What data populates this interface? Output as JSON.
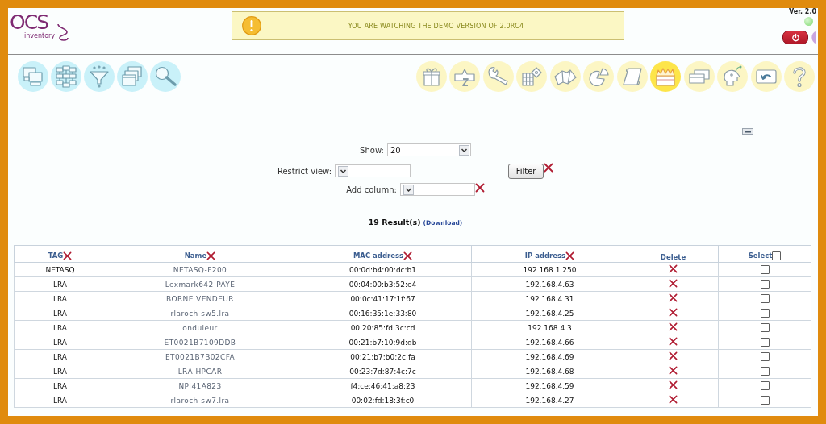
{
  "header": {
    "logo": {
      "name": "OCS",
      "subtitle": "inventory"
    },
    "demo_notice": "YOU ARE WATCHING THE DEMO VERSION OF 2.0RC4",
    "version": "Ver. 2.0"
  },
  "toolbar_left": [
    {
      "selected": false
    },
    {
      "selected": false
    },
    {
      "selected": false
    },
    {
      "selected": false
    },
    {
      "selected": false
    }
  ],
  "toolbar_right": [
    {
      "selected": false
    },
    {
      "selected": false
    },
    {
      "selected": false
    },
    {
      "selected": false
    },
    {
      "selected": false
    },
    {
      "selected": false
    },
    {
      "selected": false
    },
    {
      "selected": true
    },
    {
      "selected": false
    },
    {
      "selected": false
    },
    {
      "selected": false
    },
    {
      "selected": false
    }
  ],
  "filters": {
    "show": {
      "label": "Show:",
      "value": "20"
    },
    "restrict_view": {
      "label": "Restrict view:"
    },
    "filter_button": "Filter",
    "add_column": {
      "label": "Add column:"
    }
  },
  "results": {
    "count": "19 Result(s)",
    "download": "(Download)"
  },
  "table": {
    "columns": [
      {
        "label": "TAG",
        "kind": "text"
      },
      {
        "label": "Name",
        "kind": "link"
      },
      {
        "label": "MAC address",
        "kind": "text"
      },
      {
        "label": "IP address",
        "kind": "text"
      },
      {
        "label": "Delete",
        "kind": "delete"
      },
      {
        "label": "Select",
        "kind": "select",
        "checked": false
      }
    ],
    "rows": [
      {
        "cells": [
          "NETASQ",
          "NETASQ-F200",
          "00:0d:b4:00:dc:b1",
          "192.168.1.250"
        ],
        "checked": false
      },
      {
        "cells": [
          "LRA",
          "Lexmark642-PAYE",
          "00:04:00:b3:52:e4",
          "192.168.4.63"
        ],
        "checked": false
      },
      {
        "cells": [
          "LRA",
          "BORNE VENDEUR",
          "00:0c:41:17:1f:67",
          "192.168.4.31"
        ],
        "checked": false
      },
      {
        "cells": [
          "LRA",
          "rlaroch-sw5.lra",
          "00:16:35:1e:33:80",
          "192.168.4.25"
        ],
        "checked": false
      },
      {
        "cells": [
          "LRA",
          "onduleur",
          "00:20:85:fd:3c:cd",
          "192.168.4.3"
        ],
        "checked": false
      },
      {
        "cells": [
          "LRA",
          "ET0021B7109DDB",
          "00:21:b7:10:9d:db",
          "192.168.4.66"
        ],
        "checked": false
      },
      {
        "cells": [
          "LRA",
          "ET0021B7B02CFA",
          "00:21:b7:b0:2c:fa",
          "192.168.4.69"
        ],
        "checked": false
      },
      {
        "cells": [
          "LRA",
          "LRA-HPCAR",
          "00:23:7d:87:4c:7c",
          "192.168.4.68"
        ],
        "checked": false
      },
      {
        "cells": [
          "LRA",
          "NPI41A823",
          "f4:ce:46:41:a8:23",
          "192.168.4.59"
        ],
        "checked": false
      },
      {
        "cells": [
          "LRA",
          "rlaroch-sw7.lra",
          "00:02:fd:18:3f:c0",
          "192.168.4.27"
        ],
        "checked": false
      }
    ]
  }
}
